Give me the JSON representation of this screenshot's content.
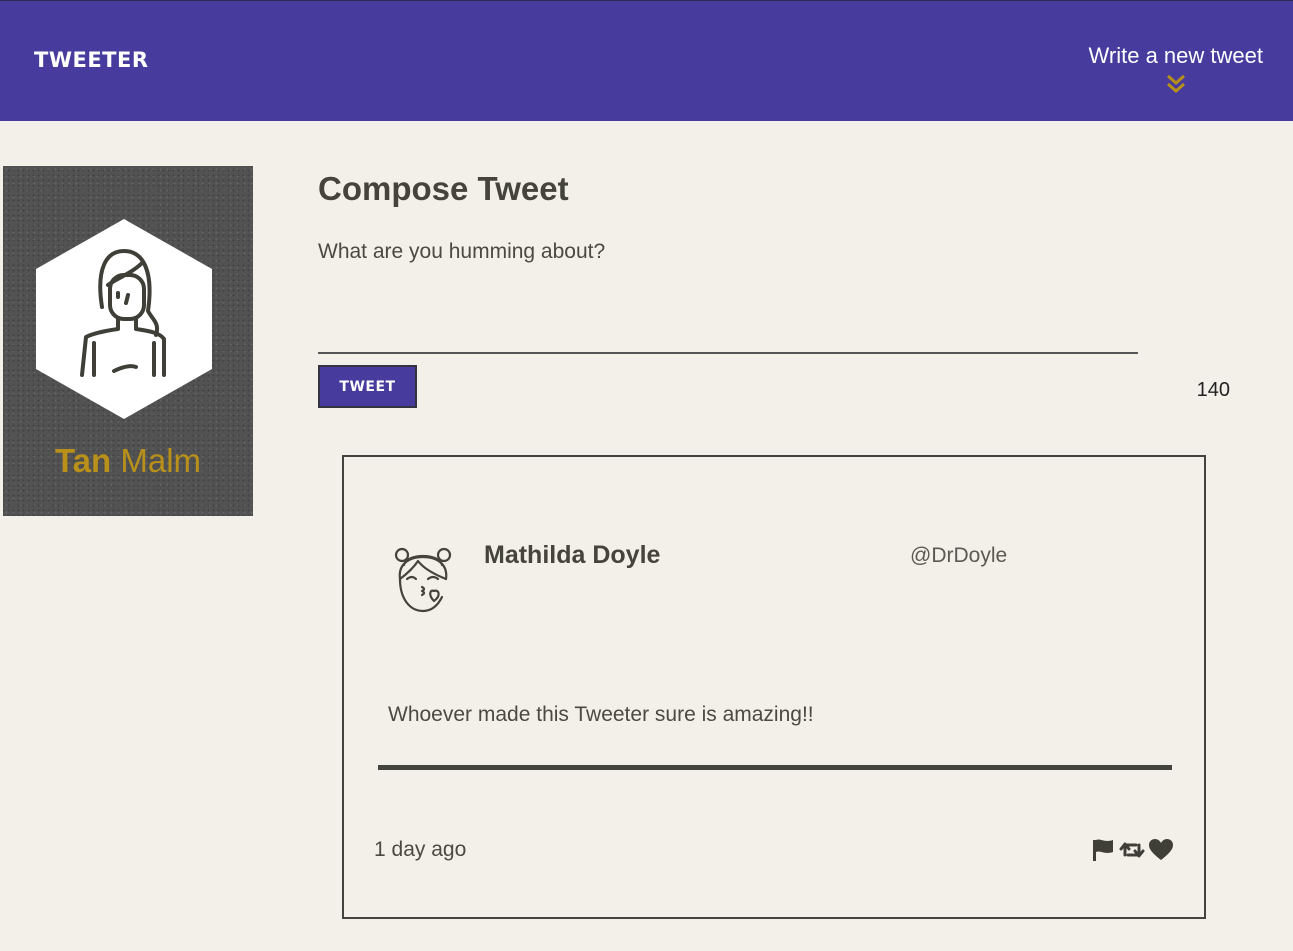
{
  "nav": {
    "brand": "TWEETER",
    "compose_label": "Write a new tweet",
    "compose_icon": "double-chevron-down-icon",
    "accent": "#473c9e",
    "chevron_color": "#b8901a"
  },
  "profile": {
    "first_name": "Tan",
    "last_name": "Malm",
    "avatar": "user-avatar-icon"
  },
  "compose": {
    "title": "Compose Tweet",
    "placeholder": "What are you humming about?",
    "value": "",
    "button_label": "TWEET",
    "counter": "140"
  },
  "tweets": [
    {
      "name": "Mathilda Doyle",
      "handle": "@DrDoyle",
      "avatar": "kissing-face-avatar-icon",
      "content": "Whoever made this Tweeter sure is amazing!!",
      "time": "1 day ago",
      "actions": [
        "flag-icon",
        "retweet-icon",
        "heart-icon"
      ]
    }
  ]
}
